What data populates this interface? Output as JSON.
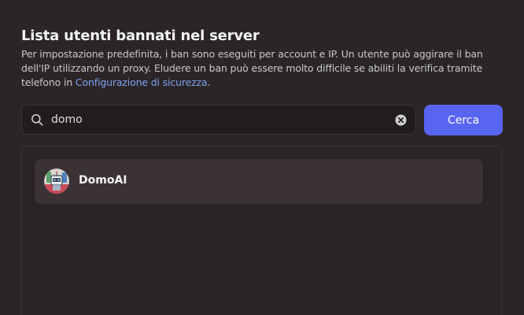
{
  "header": {
    "title": "Lista utenti bannati nel server",
    "description": "Per impostazione predefinita, i ban sono eseguiti per account e IP. Un utente può aggirare il ban dell'IP utilizzando un proxy. Eludere un ban può essere molto difficile se abiliti la verifica tramite telefono in ",
    "link_text": "Configurazione di sicurezza",
    "trailing_text": "."
  },
  "search": {
    "value": "domo",
    "placeholder": "Cerca",
    "button_label": "Cerca",
    "search_icon": "search-icon",
    "clear_icon": "clear-icon"
  },
  "results": [
    {
      "username": "DomoAI",
      "avatar": "domoai-avatar"
    }
  ],
  "colors": {
    "background": "#2c2527",
    "accent": "#5865f2",
    "link": "#7aa3f0",
    "row": "#3a3235"
  }
}
